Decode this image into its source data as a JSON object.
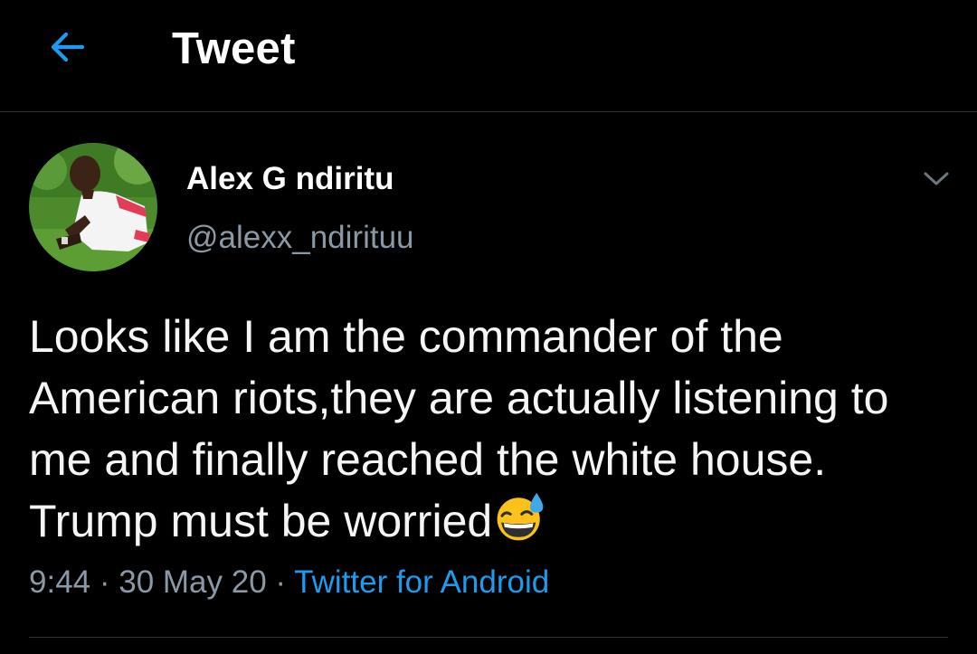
{
  "header": {
    "back_icon": "arrow-left-icon",
    "title": "Tweet"
  },
  "tweet": {
    "author": {
      "name": "Alex G ndiritu",
      "handle": "@alexx_ndirituu",
      "avatar_icon": "profile-photo"
    },
    "menu_icon": "chevron-down-icon",
    "text": "Looks like I am the commander of the American riots,they are actually listening to me and finally reached the white house. Trump must be worried",
    "emoji": "grinning-face-with-sweat-emoji",
    "time": "9:44",
    "separator": " · ",
    "date": "30 May 20",
    "source": "Twitter for Android"
  },
  "colors": {
    "background": "#000000",
    "accent": "#1d9bf0",
    "secondary_text": "#8b98a5",
    "divider": "#2f3336"
  }
}
